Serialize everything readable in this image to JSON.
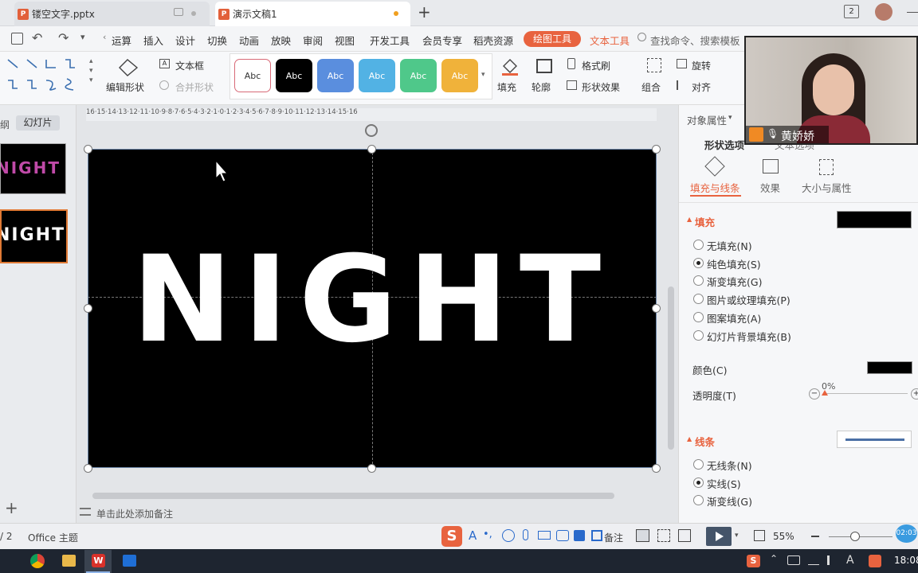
{
  "tabs": [
    {
      "label": "镂空文字.pptx"
    },
    {
      "label": "演示文稿1"
    }
  ],
  "tab_new": "+",
  "tab_badge": "2",
  "menu": {
    "items": [
      "运算",
      "插入",
      "设计",
      "切换",
      "动画",
      "放映",
      "审阅",
      "视图",
      "开发工具",
      "会员专享",
      "稻壳资源"
    ],
    "active": "绘图工具",
    "text_tool": "文本工具",
    "search_placeholder": "查找命令、搜索模板"
  },
  "ribbon": {
    "edit_shape": "编辑形状",
    "textbox": "文本框",
    "merge_shape": "合并形状",
    "styles": [
      {
        "label": "Abc",
        "bg": "#ffffff",
        "fg": "#333333",
        "border": "#d86a77"
      },
      {
        "label": "Abc",
        "bg": "#000000",
        "fg": "#ffffff",
        "border": "#000000"
      },
      {
        "label": "Abc",
        "bg": "#5a8ede",
        "fg": "#ffffff",
        "border": "#5a8ede"
      },
      {
        "label": "Abc",
        "bg": "#52b2e4",
        "fg": "#ffffff",
        "border": "#52b2e4"
      },
      {
        "label": "Abc",
        "bg": "#4fc88a",
        "fg": "#ffffff",
        "border": "#4fc88a"
      },
      {
        "label": "Abc",
        "bg": "#f0b23a",
        "fg": "#ffffff",
        "border": "#f0b23a"
      }
    ],
    "fill": "填充",
    "outline": "轮廓",
    "format_painter": "格式刷",
    "shape_effect": "形状效果",
    "group": "组合",
    "rotate": "旋转",
    "align": "对齐"
  },
  "left_panel": {
    "tab_outline": "纲",
    "tab_slides": "幻灯片",
    "thumb1_text": "NIGHT",
    "thumb2_text": "NIGHT"
  },
  "ruler_ticks": "16·15·14·13·12·11·10·9·8·7·6·5·4·3·2·1·0·1·2·3·4·5·6·7·8·9·10·11·12·13·14·15·16",
  "slide": {
    "text": "NIGHT",
    "bg": "#000000",
    "text_color": "#ffffff"
  },
  "notes_placeholder": "单击此处添加备注",
  "right_panel": {
    "title": "对象属性",
    "tabs": [
      "形状选项",
      "文本选项"
    ],
    "subtabs": [
      "填充与线条",
      "效果",
      "大小与属性"
    ],
    "fill_section": "填充",
    "fill_options": [
      {
        "label": "无填充(N)",
        "selected": false
      },
      {
        "label": "纯色填充(S)",
        "selected": true
      },
      {
        "label": "渐变填充(G)",
        "selected": false
      },
      {
        "label": "图片或纹理填充(P)",
        "selected": false
      },
      {
        "label": "图案填充(A)",
        "selected": false
      },
      {
        "label": "幻灯片背景填充(B)",
        "selected": false
      }
    ],
    "color_label": "颜色(C)",
    "transparency_label": "透明度(T)",
    "transparency_value": "0%",
    "line_section": "线条",
    "line_options": [
      {
        "label": "无线条(N)",
        "selected": false
      },
      {
        "label": "实线(S)",
        "selected": true
      },
      {
        "label": "渐变线(G)",
        "selected": false
      }
    ]
  },
  "webcam": {
    "name": "黄娇娇"
  },
  "status": {
    "page": "/ 2",
    "theme": "Office 主题",
    "notes": "备注",
    "zoom": "55%",
    "timer": "02:03"
  },
  "taskbar": {
    "time": "18:08"
  },
  "colors": {
    "accent": "#e8633f",
    "selection_blue": "#4a6fa5"
  }
}
